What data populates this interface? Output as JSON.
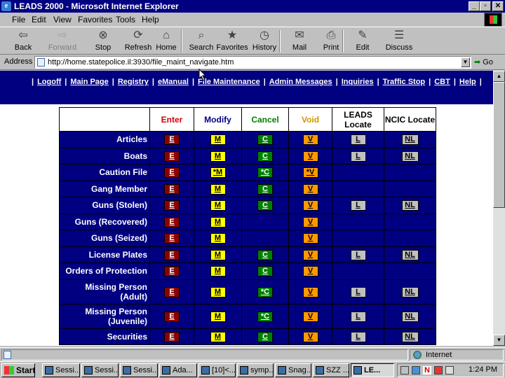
{
  "window": {
    "title": "LEADS 2000 - Microsoft Internet Explorer",
    "controls": [
      "_",
      "▫",
      "✕"
    ]
  },
  "menu": [
    "File",
    "Edit",
    "View",
    "Favorites",
    "Tools",
    "Help"
  ],
  "toolbar": [
    {
      "label": "Back",
      "icon": "back-arrow-icon",
      "glyph": "⇦",
      "enabled": true
    },
    {
      "label": "Forward",
      "icon": "forward-arrow-icon",
      "glyph": "⇨",
      "enabled": false
    },
    {
      "label": "Stop",
      "icon": "stop-icon",
      "glyph": "⊗",
      "enabled": true
    },
    {
      "label": "Refresh",
      "icon": "refresh-icon",
      "glyph": "⟳",
      "enabled": true
    },
    {
      "label": "Home",
      "icon": "home-icon",
      "glyph": "⌂",
      "enabled": true
    },
    {
      "label": "Search",
      "icon": "search-icon",
      "glyph": "⌕",
      "enabled": true
    },
    {
      "label": "Favorites",
      "icon": "favorites-icon",
      "glyph": "★",
      "enabled": true
    },
    {
      "label": "History",
      "icon": "history-icon",
      "glyph": "◷",
      "enabled": true
    },
    {
      "label": "Mail",
      "icon": "mail-icon",
      "glyph": "✉",
      "enabled": true
    },
    {
      "label": "Print",
      "icon": "print-icon",
      "glyph": "⎙",
      "enabled": true
    },
    {
      "label": "Edit",
      "icon": "edit-icon",
      "glyph": "✎",
      "enabled": true
    },
    {
      "label": "Discuss",
      "icon": "discuss-icon",
      "glyph": "☰",
      "enabled": true
    }
  ],
  "address": {
    "label": "Address",
    "url": "http://home.statepolice.il:3930/file_maint_navigate.htm",
    "go_label": "Go"
  },
  "nav_links": [
    "Logoff",
    "Main Page",
    "Registry",
    "eManual",
    "File Maintenance",
    "Admin Messages",
    "Inquiries",
    "Traffic Stop",
    "CBT",
    "Help"
  ],
  "table": {
    "headers": [
      "",
      "Enter",
      "Modify",
      "Cancel",
      "Void",
      "LEADS Locate",
      "NCIC Locate"
    ],
    "header_colors": [
      "#000000",
      "#cc0000",
      "#000080",
      "#008000",
      "#cc9900",
      "#000000",
      "#000000"
    ],
    "rows": [
      {
        "label": "Articles",
        "enter": "E",
        "modify": "M",
        "cancel": "C",
        "void": "V",
        "leads": "L",
        "ncic": "NL"
      },
      {
        "label": "Boats",
        "enter": "E",
        "modify": "M",
        "cancel": "C",
        "void": "V",
        "leads": "L",
        "ncic": "NL"
      },
      {
        "label": "Caution File",
        "enter": "E",
        "modify": "*M",
        "cancel": "*C",
        "void": "*V",
        "leads": "",
        "ncic": ""
      },
      {
        "label": "Gang Member",
        "enter": "E",
        "modify": "M",
        "cancel": "C",
        "void": "V",
        "leads": "",
        "ncic": ""
      },
      {
        "label": "Guns (Stolen)",
        "enter": "E",
        "modify": "M",
        "cancel": "C",
        "void": "V",
        "leads": "L",
        "ncic": "NL"
      },
      {
        "label": "Guns (Recovered)",
        "enter": "E",
        "modify": "M",
        "cancel": "",
        "void": "V",
        "leads": "",
        "ncic": ""
      },
      {
        "label": "Guns (Seized)",
        "enter": "E",
        "modify": "M",
        "cancel": "",
        "void": "V",
        "leads": "",
        "ncic": ""
      },
      {
        "label": "License Plates",
        "enter": "E",
        "modify": "M",
        "cancel": "C",
        "void": "V",
        "leads": "L",
        "ncic": "NL"
      },
      {
        "label": "Orders of Protection",
        "enter": "E",
        "modify": "M",
        "cancel": "C",
        "void": "V",
        "leads": "",
        "ncic": ""
      },
      {
        "label": "Missing Person\n(Adult)",
        "enter": "E",
        "modify": "M",
        "cancel": "*C",
        "void": "V",
        "leads": "L",
        "ncic": "NL"
      },
      {
        "label": "Missing Person\n(Juvenile)",
        "enter": "E",
        "modify": "M",
        "cancel": "*C",
        "void": "V",
        "leads": "L",
        "ncic": "NL"
      },
      {
        "label": "Securities",
        "enter": "E",
        "modify": "M",
        "cancel": "C",
        "void": "V",
        "leads": "L",
        "ncic": "NL"
      }
    ]
  },
  "status": {
    "zone": "Internet"
  },
  "taskbar": {
    "start_label": "Start",
    "tasks": [
      "Sessi...",
      "Sessi...",
      "Sessi...",
      "Ada...",
      "[10]<...",
      "symp...",
      "Snag...",
      "SZZ ...",
      "LE..."
    ],
    "active_task": 8,
    "clock": "1:24 PM"
  }
}
